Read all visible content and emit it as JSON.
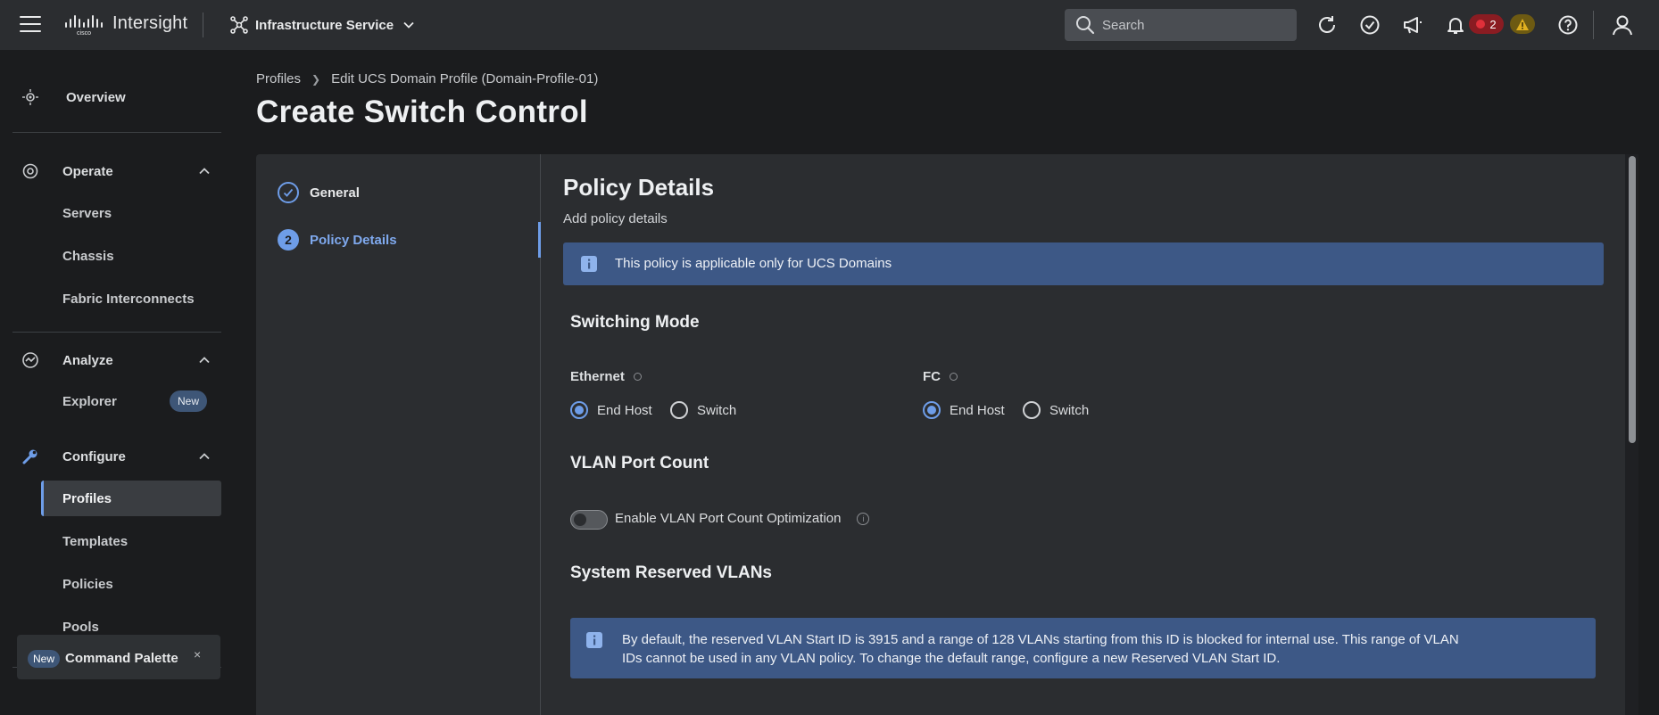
{
  "topbar": {
    "app_name": "Intersight",
    "service": "Infrastructure Service",
    "search_placeholder": "Search",
    "alarm_critical_count": "2"
  },
  "sidebar": {
    "overview": "Overview",
    "operate": {
      "label": "Operate",
      "items": [
        "Servers",
        "Chassis",
        "Fabric Interconnects"
      ]
    },
    "analyze": {
      "label": "Analyze",
      "items": [
        "Explorer"
      ],
      "new_badge": "New"
    },
    "configure": {
      "label": "Configure",
      "items": [
        "Profiles",
        "Templates",
        "Policies",
        "Pools"
      ],
      "active": "Profiles"
    },
    "command_palette": {
      "badge": "New",
      "label": "Command Palette",
      "close": "×"
    }
  },
  "breadcrumb": {
    "items": [
      "Profiles",
      "Edit UCS Domain Profile (Domain-Profile-01)"
    ]
  },
  "page_title": "Create Switch Control",
  "steps": [
    {
      "number": "",
      "label": "General",
      "state": "done"
    },
    {
      "number": "2",
      "label": "Policy Details",
      "state": "current"
    }
  ],
  "policy": {
    "title": "Policy Details",
    "subtitle": "Add policy details",
    "info_banner": "This policy is applicable only for UCS Domains",
    "switching_mode": {
      "title": "Switching Mode",
      "ethernet": {
        "label": "Ethernet",
        "options": [
          "End Host",
          "Switch"
        ],
        "selected": "End Host"
      },
      "fc": {
        "label": "FC",
        "options": [
          "End Host",
          "Switch"
        ],
        "selected": "End Host"
      }
    },
    "vlan_port_count": {
      "title": "VLAN Port Count",
      "toggle_label": "Enable VLAN Port Count Optimization",
      "enabled": false
    },
    "reserved_vlans": {
      "title": "System Reserved VLANs",
      "info": "By default, the reserved VLAN Start ID is 3915 and a range of 128 VLANs starting from this ID is blocked for internal use. This range of VLAN IDs cannot be used in any VLAN policy. To change the default range, configure a new Reserved VLAN Start ID."
    }
  },
  "colors": {
    "accent": "#6e9de8",
    "banner": "#3d5886",
    "topbar": "#2b2d30",
    "background": "#1b1c1e",
    "alarm_critical": "#e0303a",
    "alarm_warning": "#e0b020"
  }
}
